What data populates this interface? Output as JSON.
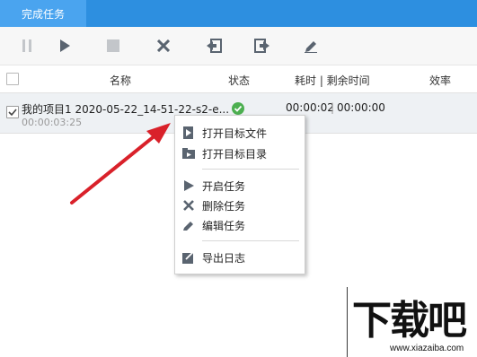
{
  "tabs": [
    {
      "label": "完成任务",
      "active": true
    }
  ],
  "toolbar": {
    "buttons": [
      {
        "name": "pause",
        "icon": "pause-icon",
        "enabled": false
      },
      {
        "name": "start",
        "icon": "play-icon",
        "enabled": true
      },
      {
        "name": "stop",
        "icon": "stop-icon",
        "enabled": false
      },
      {
        "name": "delete",
        "icon": "close-icon",
        "enabled": true
      },
      {
        "name": "import",
        "icon": "import-icon",
        "enabled": true
      },
      {
        "name": "export",
        "icon": "export-icon",
        "enabled": true
      },
      {
        "name": "edit",
        "icon": "edit-icon",
        "enabled": true
      }
    ]
  },
  "table": {
    "columns": [
      "名称",
      "状态",
      "耗时 | 剩余时间",
      "效率"
    ],
    "rows": [
      {
        "checked": true,
        "name": "我的项目1 2020-05-22_14-51-22-s2-e...",
        "sub": "00:00:03:25",
        "status_icon": "check-circle-icon",
        "elapsed": "00:00:02",
        "separator": "|",
        "remaining": "00:00:00"
      }
    ]
  },
  "context_menu": {
    "items": [
      {
        "label": "打开目标文件",
        "icon": "open-file-icon"
      },
      {
        "label": "打开目标目录",
        "icon": "open-folder-icon"
      },
      {
        "label": "开启任务",
        "icon": "play-icon"
      },
      {
        "label": "删除任务",
        "icon": "close-icon"
      },
      {
        "label": "编辑任务",
        "icon": "edit-icon"
      },
      {
        "label": "导出日志",
        "icon": "export-log-icon"
      }
    ]
  },
  "watermark": {
    "text": "下载吧",
    "url": "www.xiazaiba.com"
  },
  "colors": {
    "titlebar": "#2d8fe0",
    "tab_active": "#4aa4ef",
    "icon_gray": "#5a6470",
    "arrow": "#d9212a",
    "status_ok": "#4caf50"
  }
}
